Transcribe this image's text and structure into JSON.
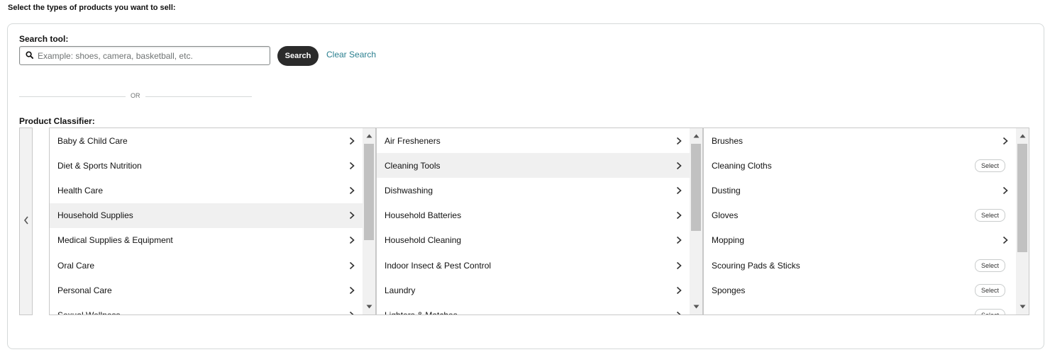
{
  "page": {
    "heading": "Select the types of products you want to sell:"
  },
  "search": {
    "label": "Search tool:",
    "placeholder": "Example: shoes, camera, basketball, etc.",
    "button_label": "Search",
    "clear_label": "Clear Search",
    "icon": "search-icon"
  },
  "divider": {
    "text": "OR"
  },
  "classifier": {
    "label": "Product Classifier:",
    "back_icon": "chevron-left-icon",
    "columns": [
      {
        "items": [
          {
            "label": "Baby & Child Care",
            "action": "chevron"
          },
          {
            "label": "Diet & Sports Nutrition",
            "action": "chevron"
          },
          {
            "label": "Health Care",
            "action": "chevron"
          },
          {
            "label": "Household Supplies",
            "action": "chevron",
            "selected": true
          },
          {
            "label": "Medical Supplies & Equipment",
            "action": "chevron"
          },
          {
            "label": "Oral Care",
            "action": "chevron"
          },
          {
            "label": "Personal Care",
            "action": "chevron"
          },
          {
            "label": "Sexual Wellness",
            "action": "chevron"
          }
        ],
        "scroll_position": 0.0,
        "visible_fraction": 0.62
      },
      {
        "items": [
          {
            "label": "Air Fresheners",
            "action": "chevron"
          },
          {
            "label": "Cleaning Tools",
            "action": "chevron",
            "selected": true
          },
          {
            "label": "Dishwashing",
            "action": "chevron"
          },
          {
            "label": "Household Batteries",
            "action": "chevron"
          },
          {
            "label": "Household Cleaning",
            "action": "chevron"
          },
          {
            "label": "Indoor Insect & Pest Control",
            "action": "chevron"
          },
          {
            "label": "Laundry",
            "action": "chevron"
          },
          {
            "label": "Lighters & Matches",
            "action": "chevron"
          }
        ],
        "scroll_position": 0.0,
        "visible_fraction": 0.56
      },
      {
        "items": [
          {
            "label": "Brushes",
            "action": "chevron"
          },
          {
            "label": "Cleaning Cloths",
            "action": "select"
          },
          {
            "label": "Dusting",
            "action": "chevron"
          },
          {
            "label": "Gloves",
            "action": "select"
          },
          {
            "label": "Mopping",
            "action": "chevron"
          },
          {
            "label": "Scouring Pads & Sticks",
            "action": "select"
          },
          {
            "label": "Sponges",
            "action": "select"
          },
          {
            "label": "",
            "action": "select"
          }
        ],
        "select_label": "Select",
        "scroll_position": 0.0,
        "visible_fraction": 0.7
      }
    ]
  },
  "colors": {
    "search_button_bg": "#2b2b2b",
    "link": "#2a7f8f",
    "selected_row_bg": "#f0f0f0",
    "border": "#c8c8c8"
  }
}
